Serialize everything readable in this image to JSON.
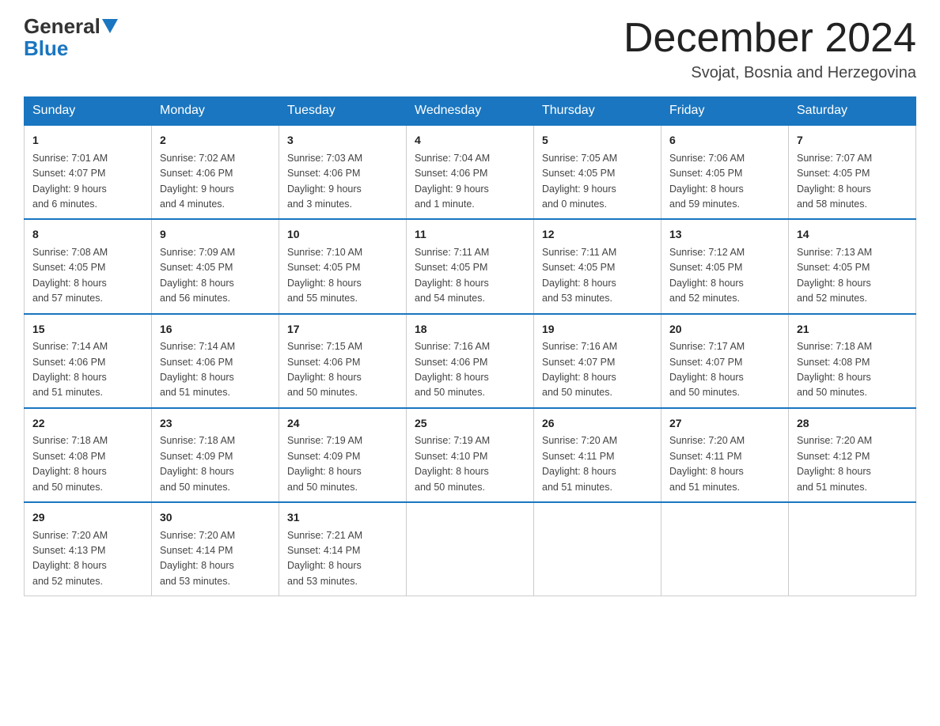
{
  "header": {
    "logo_general": "General",
    "logo_blue": "Blue",
    "month_title": "December 2024",
    "location": "Svojat, Bosnia and Herzegovina"
  },
  "weekdays": [
    "Sunday",
    "Monday",
    "Tuesday",
    "Wednesday",
    "Thursday",
    "Friday",
    "Saturday"
  ],
  "weeks": [
    [
      {
        "day": "1",
        "sunrise": "7:01 AM",
        "sunset": "4:07 PM",
        "daylight": "9 hours and 6 minutes."
      },
      {
        "day": "2",
        "sunrise": "7:02 AM",
        "sunset": "4:06 PM",
        "daylight": "9 hours and 4 minutes."
      },
      {
        "day": "3",
        "sunrise": "7:03 AM",
        "sunset": "4:06 PM",
        "daylight": "9 hours and 3 minutes."
      },
      {
        "day": "4",
        "sunrise": "7:04 AM",
        "sunset": "4:06 PM",
        "daylight": "9 hours and 1 minute."
      },
      {
        "day": "5",
        "sunrise": "7:05 AM",
        "sunset": "4:05 PM",
        "daylight": "9 hours and 0 minutes."
      },
      {
        "day": "6",
        "sunrise": "7:06 AM",
        "sunset": "4:05 PM",
        "daylight": "8 hours and 59 minutes."
      },
      {
        "day": "7",
        "sunrise": "7:07 AM",
        "sunset": "4:05 PM",
        "daylight": "8 hours and 58 minutes."
      }
    ],
    [
      {
        "day": "8",
        "sunrise": "7:08 AM",
        "sunset": "4:05 PM",
        "daylight": "8 hours and 57 minutes."
      },
      {
        "day": "9",
        "sunrise": "7:09 AM",
        "sunset": "4:05 PM",
        "daylight": "8 hours and 56 minutes."
      },
      {
        "day": "10",
        "sunrise": "7:10 AM",
        "sunset": "4:05 PM",
        "daylight": "8 hours and 55 minutes."
      },
      {
        "day": "11",
        "sunrise": "7:11 AM",
        "sunset": "4:05 PM",
        "daylight": "8 hours and 54 minutes."
      },
      {
        "day": "12",
        "sunrise": "7:11 AM",
        "sunset": "4:05 PM",
        "daylight": "8 hours and 53 minutes."
      },
      {
        "day": "13",
        "sunrise": "7:12 AM",
        "sunset": "4:05 PM",
        "daylight": "8 hours and 52 minutes."
      },
      {
        "day": "14",
        "sunrise": "7:13 AM",
        "sunset": "4:05 PM",
        "daylight": "8 hours and 52 minutes."
      }
    ],
    [
      {
        "day": "15",
        "sunrise": "7:14 AM",
        "sunset": "4:06 PM",
        "daylight": "8 hours and 51 minutes."
      },
      {
        "day": "16",
        "sunrise": "7:14 AM",
        "sunset": "4:06 PM",
        "daylight": "8 hours and 51 minutes."
      },
      {
        "day": "17",
        "sunrise": "7:15 AM",
        "sunset": "4:06 PM",
        "daylight": "8 hours and 50 minutes."
      },
      {
        "day": "18",
        "sunrise": "7:16 AM",
        "sunset": "4:06 PM",
        "daylight": "8 hours and 50 minutes."
      },
      {
        "day": "19",
        "sunrise": "7:16 AM",
        "sunset": "4:07 PM",
        "daylight": "8 hours and 50 minutes."
      },
      {
        "day": "20",
        "sunrise": "7:17 AM",
        "sunset": "4:07 PM",
        "daylight": "8 hours and 50 minutes."
      },
      {
        "day": "21",
        "sunrise": "7:18 AM",
        "sunset": "4:08 PM",
        "daylight": "8 hours and 50 minutes."
      }
    ],
    [
      {
        "day": "22",
        "sunrise": "7:18 AM",
        "sunset": "4:08 PM",
        "daylight": "8 hours and 50 minutes."
      },
      {
        "day": "23",
        "sunrise": "7:18 AM",
        "sunset": "4:09 PM",
        "daylight": "8 hours and 50 minutes."
      },
      {
        "day": "24",
        "sunrise": "7:19 AM",
        "sunset": "4:09 PM",
        "daylight": "8 hours and 50 minutes."
      },
      {
        "day": "25",
        "sunrise": "7:19 AM",
        "sunset": "4:10 PM",
        "daylight": "8 hours and 50 minutes."
      },
      {
        "day": "26",
        "sunrise": "7:20 AM",
        "sunset": "4:11 PM",
        "daylight": "8 hours and 51 minutes."
      },
      {
        "day": "27",
        "sunrise": "7:20 AM",
        "sunset": "4:11 PM",
        "daylight": "8 hours and 51 minutes."
      },
      {
        "day": "28",
        "sunrise": "7:20 AM",
        "sunset": "4:12 PM",
        "daylight": "8 hours and 51 minutes."
      }
    ],
    [
      {
        "day": "29",
        "sunrise": "7:20 AM",
        "sunset": "4:13 PM",
        "daylight": "8 hours and 52 minutes."
      },
      {
        "day": "30",
        "sunrise": "7:20 AM",
        "sunset": "4:14 PM",
        "daylight": "8 hours and 53 minutes."
      },
      {
        "day": "31",
        "sunrise": "7:21 AM",
        "sunset": "4:14 PM",
        "daylight": "8 hours and 53 minutes."
      },
      null,
      null,
      null,
      null
    ]
  ],
  "labels": {
    "sunrise": "Sunrise:",
    "sunset": "Sunset:",
    "daylight": "Daylight:"
  }
}
